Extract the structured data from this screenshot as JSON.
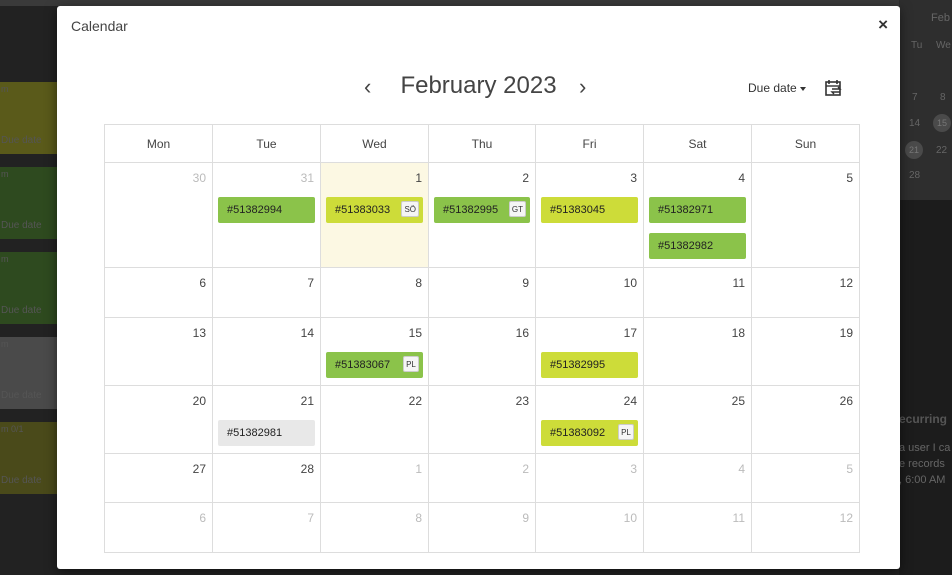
{
  "background": {
    "strip_labels": [
      "Due date",
      "Due date",
      "Due date",
      "Due date",
      "Due date"
    ],
    "strip_top_text": [
      "m",
      "m",
      "m",
      "m",
      "m  0/1"
    ],
    "right_header": "Feb",
    "right_weekdays": [
      "Tu",
      "We"
    ],
    "right_rows": [
      [
        "7",
        "8"
      ],
      [
        "14",
        "15"
      ],
      [
        "21",
        "22"
      ],
      [
        "28",
        ""
      ]
    ],
    "recurring_heading": "ecurring",
    "recurring_line1": "a user I ca",
    "recurring_line2": "e records",
    "recurring_line3": ", 6:00 AM",
    "colors": [
      "#5a5a1a",
      "#2e4a1f",
      "#4a4a1a"
    ]
  },
  "modal": {
    "title": "Calendar",
    "close_icon": "×",
    "prev_icon": "‹",
    "next_icon": "›",
    "month": "February 2023",
    "due_date_label": "Due date",
    "weekdays": [
      "Mon",
      "Tue",
      "Wed",
      "Thu",
      "Fri",
      "Sat",
      "Sun"
    ]
  },
  "calendar": {
    "accent_colors": {
      "green": "#8bc34a",
      "lime": "#cddc39",
      "gray": "#e8e8e8",
      "today": "#fcf8e3"
    },
    "weeks": [
      [
        {
          "day": "30",
          "other": true,
          "events": []
        },
        {
          "day": "31",
          "other": true,
          "events": [
            {
              "label": "#51382994",
              "color": "green"
            }
          ]
        },
        {
          "day": "1",
          "today": true,
          "events": [
            {
              "label": "#51383033",
              "color": "lime",
              "badge": "SÖ"
            }
          ]
        },
        {
          "day": "2",
          "events": [
            {
              "label": "#51382995",
              "color": "green",
              "badge": "GT"
            }
          ]
        },
        {
          "day": "3",
          "events": [
            {
              "label": "#51383045",
              "color": "lime"
            }
          ]
        },
        {
          "day": "4",
          "events": [
            {
              "label": "#51382971",
              "color": "green"
            },
            {
              "label": "#51382982",
              "color": "green"
            }
          ]
        },
        {
          "day": "5",
          "events": []
        }
      ],
      [
        {
          "day": "6",
          "events": []
        },
        {
          "day": "7",
          "events": []
        },
        {
          "day": "8",
          "events": []
        },
        {
          "day": "9",
          "events": []
        },
        {
          "day": "10",
          "events": []
        },
        {
          "day": "11",
          "events": []
        },
        {
          "day": "12",
          "events": []
        }
      ],
      [
        {
          "day": "13",
          "events": []
        },
        {
          "day": "14",
          "events": []
        },
        {
          "day": "15",
          "events": [
            {
              "label": "#51383067",
              "color": "green",
              "badge": "PL"
            }
          ]
        },
        {
          "day": "16",
          "events": []
        },
        {
          "day": "17",
          "events": [
            {
              "label": "#51382995",
              "color": "lime"
            }
          ]
        },
        {
          "day": "18",
          "events": []
        },
        {
          "day": "19",
          "events": []
        }
      ],
      [
        {
          "day": "20",
          "events": []
        },
        {
          "day": "21",
          "events": [
            {
              "label": "#51382981",
              "color": "gray"
            }
          ]
        },
        {
          "day": "22",
          "events": []
        },
        {
          "day": "23",
          "events": []
        },
        {
          "day": "24",
          "events": [
            {
              "label": "#51383092",
              "color": "lime",
              "badge": "PL"
            }
          ]
        },
        {
          "day": "25",
          "events": []
        },
        {
          "day": "26",
          "events": []
        }
      ],
      [
        {
          "day": "27",
          "events": []
        },
        {
          "day": "28",
          "events": []
        },
        {
          "day": "1",
          "other": true,
          "events": []
        },
        {
          "day": "2",
          "other": true,
          "events": []
        },
        {
          "day": "3",
          "other": true,
          "events": []
        },
        {
          "day": "4",
          "other": true,
          "events": []
        },
        {
          "day": "5",
          "other": true,
          "events": []
        }
      ],
      [
        {
          "day": "6",
          "other": true,
          "events": []
        },
        {
          "day": "7",
          "other": true,
          "events": []
        },
        {
          "day": "8",
          "other": true,
          "events": []
        },
        {
          "day": "9",
          "other": true,
          "events": []
        },
        {
          "day": "10",
          "other": true,
          "events": []
        },
        {
          "day": "11",
          "other": true,
          "events": []
        },
        {
          "day": "12",
          "other": true,
          "events": []
        }
      ]
    ]
  }
}
